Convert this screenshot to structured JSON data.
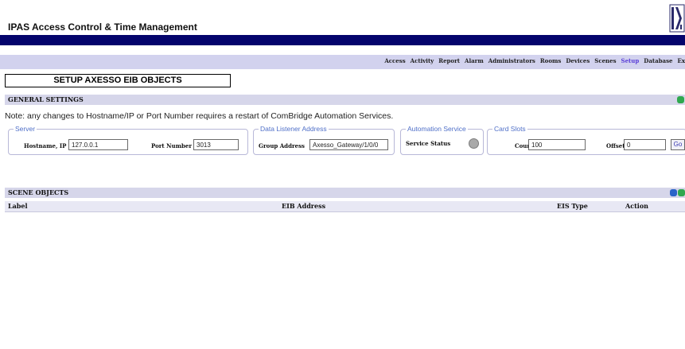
{
  "app": {
    "title": "IPAS Access Control & Time Management"
  },
  "nav": [
    {
      "label": "Access",
      "active": false
    },
    {
      "label": "Activity",
      "active": false
    },
    {
      "label": "Report",
      "active": false
    },
    {
      "label": "Alarm",
      "active": false
    },
    {
      "label": "Administrators",
      "active": false
    },
    {
      "label": "Rooms",
      "active": false
    },
    {
      "label": "Devices",
      "active": false
    },
    {
      "label": "Scenes",
      "active": false
    },
    {
      "label": "Setup",
      "active": true
    },
    {
      "label": "Database",
      "active": false
    },
    {
      "label": "Ex",
      "active": false
    }
  ],
  "page": {
    "title": "SETUP AXESSO EIB OBJECTS"
  },
  "general": {
    "header": "GENERAL SETTINGS",
    "note": "Note: any changes to Hostname/IP or Port Number requires a restart of ComBridge Automation Services.",
    "server": {
      "legend": "Server",
      "hostname_label": "Hostname, IP",
      "hostname_value": "127.0.0.1",
      "port_label": "Port Number",
      "port_value": "3013"
    },
    "listener": {
      "legend": "Data Listener Address",
      "group_label": "Group Address",
      "group_value": "Axesso_Gateway/1/0/0"
    },
    "automation": {
      "legend": "Automation Service",
      "status_label": "Service Status",
      "status_color": "#a9a9a9"
    },
    "cards": {
      "legend": "Card Slots",
      "count_label": "Count",
      "count_value": "100",
      "offset_label": "Offset",
      "offset_value": "0",
      "go_label": "Go"
    }
  },
  "scenes": {
    "header": "SCENE OBJECTS",
    "columns": {
      "label": "Label",
      "eib": "EIB Address",
      "eis": "EIS Type",
      "action": "Action"
    }
  },
  "colors": {
    "navy": "#04046c",
    "lavender": "#d2d2ee",
    "accent": "#5a3fd8",
    "legend": "#4f6fc8"
  }
}
